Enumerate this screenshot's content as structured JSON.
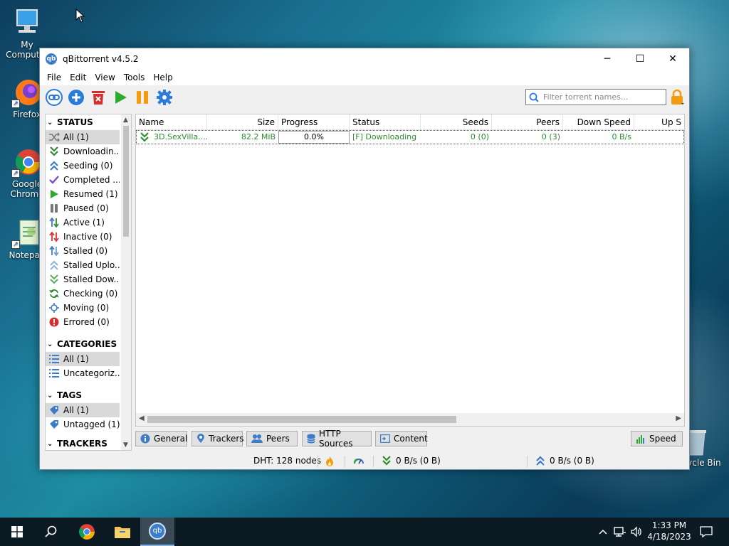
{
  "desktop": {
    "icons": [
      {
        "label": "My Computer"
      },
      {
        "label": "Firefox"
      },
      {
        "label": "Google Chrome"
      },
      {
        "label": "Notepad"
      }
    ],
    "recycle_bin": "Recycle Bin"
  },
  "window": {
    "title": "qBittorrent v4.5.2",
    "controls": {
      "minimize": "─",
      "maximize": "☐",
      "close": "✕"
    }
  },
  "menu": [
    "File",
    "Edit",
    "View",
    "Tools",
    "Help"
  ],
  "toolbar": {
    "search_placeholder": "Filter torrent names..."
  },
  "sidebar": {
    "status_header": "STATUS",
    "status_items": [
      {
        "label": "All (1)",
        "icon": "shuffle-icon",
        "color": "#777777"
      },
      {
        "label": "Downloadin...",
        "icon": "download-icon",
        "color": "#2e8b2e"
      },
      {
        "label": "Seeding (0)",
        "icon": "upload-icon",
        "color": "#3d7cc9"
      },
      {
        "label": "Completed ...",
        "icon": "check-icon",
        "color": "#7b4fc4"
      },
      {
        "label": "Resumed (1)",
        "icon": "play-icon",
        "color": "#2eaa2e"
      },
      {
        "label": "Paused (0)",
        "icon": "pause-icon",
        "color": "#777777"
      },
      {
        "label": "Active (1)",
        "icon": "active-arrows-icon",
        "color": "#2e8b2e"
      },
      {
        "label": "Inactive (0)",
        "icon": "inactive-arrows-icon",
        "color": "#d33"
      },
      {
        "label": "Stalled (0)",
        "icon": "stalled-arrows-icon",
        "color": "#3d7cc9"
      },
      {
        "label": "Stalled Uplo...",
        "icon": "stalled-upload-icon",
        "color": "#6a9ed8"
      },
      {
        "label": "Stalled Dow...",
        "icon": "stalled-download-icon",
        "color": "#5cab5c"
      },
      {
        "label": "Checking (0)",
        "icon": "refresh-icon",
        "color": "#2e8b2e"
      },
      {
        "label": "Moving (0)",
        "icon": "moving-icon",
        "color": "#3d7cc9"
      },
      {
        "label": "Errored (0)",
        "icon": "error-icon",
        "color": "#d32f2f"
      }
    ],
    "categories_header": "CATEGORIES",
    "category_items": [
      {
        "label": "All (1)"
      },
      {
        "label": "Uncategoriz..."
      }
    ],
    "tags_header": "TAGS",
    "tag_items": [
      {
        "label": "All (1)"
      },
      {
        "label": "Untagged (1)"
      }
    ],
    "trackers_header": "TRACKERS"
  },
  "table": {
    "columns": [
      "Name",
      "Size",
      "Progress",
      "Status",
      "Seeds",
      "Peers",
      "Down Speed",
      "Up S"
    ],
    "rows": [
      {
        "name": "3D.SexVilla....",
        "size": "82.2 MiB",
        "progress": "0.0%",
        "progress_value": 0.0,
        "status": "[F] Downloading",
        "seeds": "0 (0)",
        "peers": "0 (3)",
        "down_speed": "0 B/s"
      }
    ]
  },
  "tabs": [
    "General",
    "Trackers",
    "Peers",
    "HTTP Sources",
    "Content"
  ],
  "speed_button": "Speed",
  "statusbar": {
    "dht": "DHT: 128 nodes",
    "down": "0 B/s (0 B)",
    "up": "0 B/s (0 B)"
  },
  "taskbar": {
    "time": "1:33 PM",
    "date": "4/18/2023"
  }
}
